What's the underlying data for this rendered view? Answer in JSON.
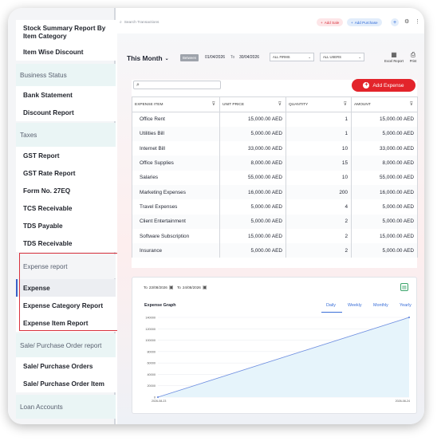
{
  "sidebar": {
    "top_item": "Stock Summary Report By Item Category",
    "item_wise_discount": "Item Wise Discount",
    "business_status": "Business Status",
    "bank_statement": "Bank Statement",
    "discount_report": "Discount Report",
    "taxes": "Taxes",
    "gst_report": "GST Report",
    "gst_rate_report": "GST Rate Report",
    "form_27eq": "Form No. 27EQ",
    "tcs_receivable": "TCS Receivable",
    "tds_payable": "TDS Payable",
    "tds_receivable": "TDS Receivable",
    "expense_report": "Expense report",
    "expense": "Expense",
    "expense_category_report": "Expense Category Report",
    "expense_item_report": "Expense Item Report",
    "sale_purchase_order_report": "Sale/ Purchase Order report",
    "sale_purchase_orders": "Sale/ Purchase Orders",
    "sale_purchase_order_item": "Sale/ Purchase Order Item",
    "loan_accounts": "Loan Accounts"
  },
  "topbar": {
    "search_placeholder": "Search Transactions",
    "add_sale": "Add Sale",
    "add_purchase": "Add Purchase",
    "plus": "+"
  },
  "toolbar": {
    "period": "This Month",
    "between": "Between",
    "from_date": "01/04/2026",
    "to": "To",
    "to_date": "30/04/2026",
    "firms": "ALL FIRMS",
    "users": "ALL USERS",
    "excel_report": "Excel Report",
    "print": "Print"
  },
  "table": {
    "add_expense": "Add Expense",
    "headers": [
      "EXPENSE ITEM",
      "UNIT PRICE",
      "QUANTITY",
      "AMOUNT"
    ],
    "rows": [
      [
        "Office Rent",
        "15,000.00 AED",
        "1",
        "15,000.00 AED"
      ],
      [
        "Utilities Bill",
        "5,000.00 AED",
        "1",
        "5,000.00 AED"
      ],
      [
        "Internet Bill",
        "33,000.00 AED",
        "10",
        "33,000.00 AED"
      ],
      [
        "Office Supplies",
        "8,000.00 AED",
        "15",
        "8,000.00 AED"
      ],
      [
        "Salaries",
        "55,000.00 AED",
        "10",
        "55,000.00 AED"
      ],
      [
        "Marketing Expenses",
        "16,000.00 AED",
        "200",
        "16,000.00 AED"
      ],
      [
        "Travel Expenses",
        "5,000.00 AED",
        "4",
        "5,000.00 AED"
      ],
      [
        "Client Entertainment",
        "5,000.00 AED",
        "2",
        "5,000.00 AED"
      ],
      [
        "Software Subscription",
        "15,000.00 AED",
        "2",
        "15,000.00 AED"
      ],
      [
        "Insurance",
        "5,000.00 AED",
        "2",
        "5,000.00 AED"
      ]
    ]
  },
  "graph": {
    "to_label_1": "To",
    "from_date": "23/08/2026",
    "to_label_2": "To",
    "to_date": "24/08/2026",
    "title": "Expense Graph",
    "tabs": [
      "Daily",
      "Weekly",
      "Monthly",
      "Yearly"
    ],
    "active_tab": "Daily"
  },
  "chart_data": {
    "type": "line",
    "title": "Expense Graph",
    "x": [
      "2026-08-23",
      "2026-08-24"
    ],
    "series": [
      {
        "values": [
          0,
          140000
        ]
      }
    ],
    "ylim": [
      0,
      140000
    ],
    "yticks": [
      "140000",
      "120000",
      "100000",
      "80000",
      "60000",
      "40000",
      "20000",
      "0"
    ],
    "xticks": [
      "2026-08-23",
      "2026-08-24"
    ],
    "line_color": "#6f8fe0",
    "fill_color": "#e6f4fb",
    "grid": true
  },
  "colors": {
    "accent_red": "#e3242b",
    "highlight_box": "#d9323e",
    "link_blue": "#3a6fd8"
  }
}
